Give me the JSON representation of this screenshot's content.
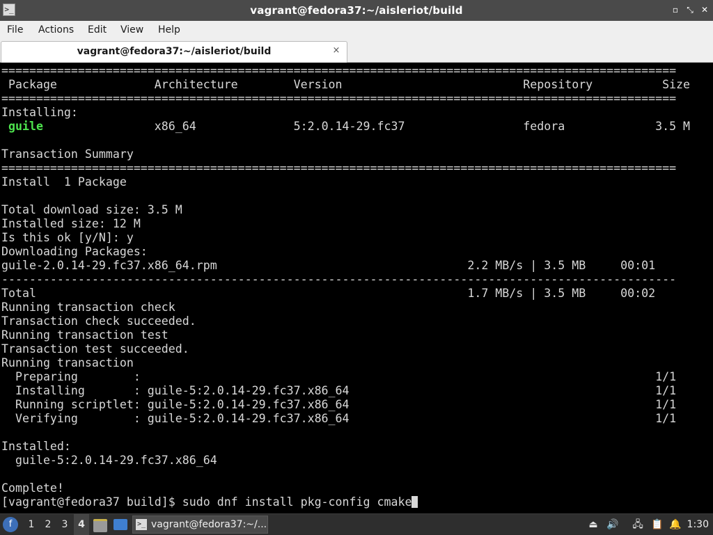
{
  "window": {
    "title": "vagrant@fedora37:~/aisleriot/build",
    "title_icon": "terminal-icon",
    "controls": {
      "minimize_glyph": "▫",
      "maximize_glyph": "⤡",
      "close_glyph": "✕"
    }
  },
  "menubar": {
    "items": [
      "File",
      "Actions",
      "Edit",
      "View",
      "Help"
    ]
  },
  "tabs": [
    {
      "label": "vagrant@fedora37:~/aisleriot/build",
      "close_glyph": "×"
    }
  ],
  "terminal": {
    "lines": [
      "=================================================================================================",
      " Package              Architecture        Version                          Repository          Size",
      "=================================================================================================",
      "Installing:",
      " guile                x86_64              5:2.0.14-29.fc37                 fedora             3.5 M",
      "",
      "Transaction Summary",
      "=================================================================================================",
      "Install  1 Package",
      "",
      "Total download size: 3.5 M",
      "Installed size: 12 M",
      "Is this ok [y/N]: y",
      "Downloading Packages:",
      "guile-2.0.14-29.fc37.x86_64.rpm                                    2.2 MB/s | 3.5 MB     00:01",
      "-------------------------------------------------------------------------------------------------",
      "Total                                                              1.7 MB/s | 3.5 MB     00:02",
      "Running transaction check",
      "Transaction check succeeded.",
      "Running transaction test",
      "Transaction test succeeded.",
      "Running transaction",
      "  Preparing        :                                                                          1/1",
      "  Installing       : guile-5:2.0.14-29.fc37.x86_64                                            1/1",
      "  Running scriptlet: guile-5:2.0.14-29.fc37.x86_64                                            1/1",
      "  Verifying        : guile-5:2.0.14-29.fc37.x86_64                                            1/1",
      "",
      "Installed:",
      "  guile-5:2.0.14-29.fc37.x86_64",
      "",
      "Complete!"
    ],
    "highlight": {
      "line_index": 4,
      "prefix": " ",
      "text": "guile",
      "suffix": "                x86_64              5:2.0.14-29.fc37                 fedora             3.5 M",
      "color": "#4ee44e"
    },
    "prompt": "[vagrant@fedora37 build]$ ",
    "command": "sudo dnf install pkg-config cmake",
    "text_color": "#d8d8d8",
    "background": "#000000"
  },
  "taskbar": {
    "start_icon": "fedora-logo-icon",
    "workspaces": [
      "1",
      "2",
      "3",
      "4"
    ],
    "active_workspace": "4",
    "launchers": [
      "file-manager-icon",
      "show-desktop-icon"
    ],
    "task": {
      "icon": "terminal-icon",
      "label": "vagrant@fedora37:~/..."
    },
    "tray": [
      "eject-icon",
      "volume-icon",
      "network-icon",
      "clipboard-icon",
      "notification-icon"
    ],
    "clock": "1:30"
  }
}
